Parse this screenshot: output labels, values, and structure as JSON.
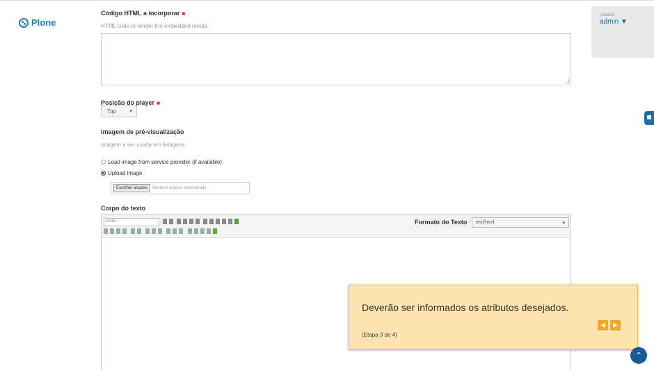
{
  "brand": {
    "name": "Plone"
  },
  "user": {
    "label": "Usuário",
    "name": "admin ▼"
  },
  "fields": {
    "embed_code": {
      "label": "Código HTML a incorporar",
      "required_mark": "■",
      "help": "HTML code to render the embedded media."
    },
    "player_position": {
      "label": "Posição do player",
      "required_mark": "■",
      "value": "Top",
      "arrow": "▾"
    },
    "preview_image": {
      "label": "Imagem de pré-visualização",
      "help": "Imagem a ser usada em listagens.",
      "options": [
        {
          "label": "Load image from service provider (if available)",
          "selected": false
        },
        {
          "label": "Upload image",
          "selected": true
        }
      ],
      "file_button": "Escolher arquivo",
      "file_status": "Nenhum arquivo selecionado"
    },
    "body_text": {
      "label": "Corpo do texto",
      "style_select": "Estilo...",
      "format_label": "Formato do Texto",
      "format_value": "text/html",
      "arrow": "▾"
    }
  },
  "tour": {
    "message": "Deverão ser informados os atributos desejados.",
    "step": "(Etapa 3 de 4)",
    "prev": "◀",
    "next": "▶"
  },
  "scroll_top": "⌃"
}
